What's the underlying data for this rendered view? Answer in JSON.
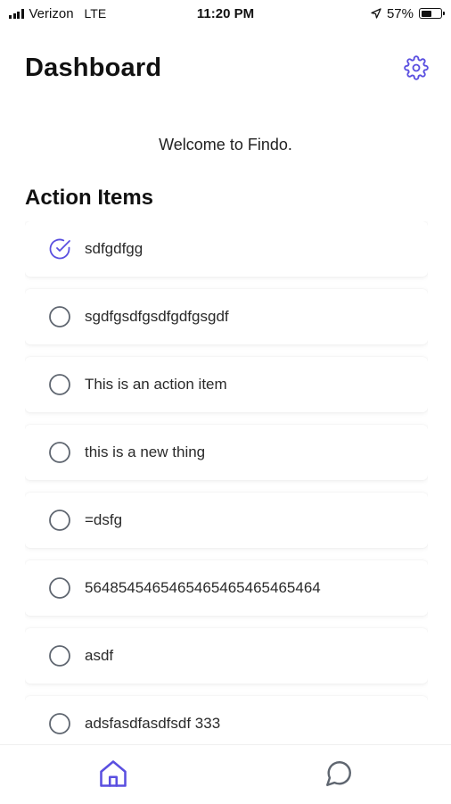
{
  "status_bar": {
    "carrier": "Verizon",
    "network": "LTE",
    "time": "11:20 PM",
    "battery": "57%",
    "battery_level": 0.57
  },
  "header": {
    "title": "Dashboard",
    "settings_icon": "gear-icon"
  },
  "welcome_text": "Welcome to Findo.",
  "action_items": {
    "title": "Action Items",
    "items": [
      {
        "label": "sdfgdfgg",
        "checked": true
      },
      {
        "label": "sgdfgsdfgsdfgdfgsgdf",
        "checked": false
      },
      {
        "label": "This is an action item",
        "checked": false
      },
      {
        "label": "this is a new thing",
        "checked": false
      },
      {
        "label": "=dsfg",
        "checked": false
      },
      {
        "label": "5648545465465465465465465464",
        "checked": false
      },
      {
        "label": "asdf",
        "checked": false
      },
      {
        "label": "adsfasdfasdfsdf 333",
        "checked": false
      }
    ]
  },
  "tab_bar": {
    "tabs": [
      {
        "icon": "home-icon",
        "active": true
      },
      {
        "icon": "chat-bubble-icon",
        "active": false
      }
    ]
  },
  "colors": {
    "accent": "#5a4fe0",
    "inactive_icon": "#5f6670",
    "text": "#1a1a1a"
  }
}
